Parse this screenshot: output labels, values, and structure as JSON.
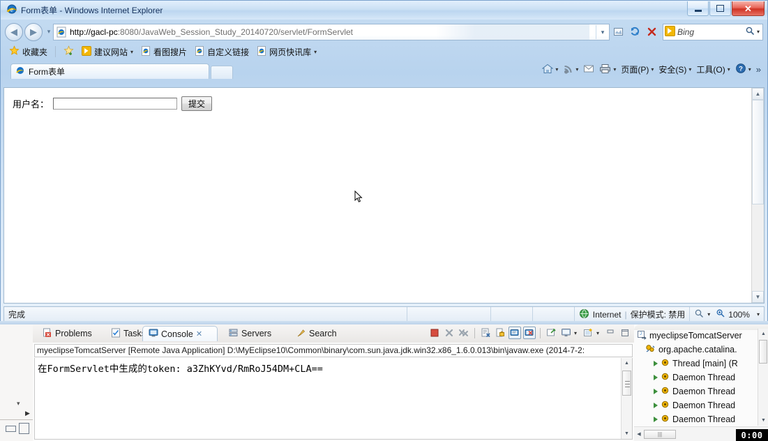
{
  "browser": {
    "title": "Form表单 - Windows Internet Explorer",
    "window_controls": {
      "minimize": "minimize-button",
      "maximize": "maximize-button",
      "close": "close-button"
    },
    "address": {
      "protocol_host": "http://gacl-pc",
      "rest": ":8080/JavaWeb_Session_Study_20140720/servlet/FormServlet",
      "full": "http://gacl-pc:8080/JavaWeb_Session_Study_20140720/servlet/FormServlet"
    },
    "search": {
      "engine": "Bing",
      "placeholder": "Bing"
    },
    "favorites": {
      "label": "收藏夹",
      "items": [
        {
          "label": "建议网站",
          "has_caret": true
        },
        {
          "label": "看图搜片",
          "has_caret": false
        },
        {
          "label": "自定义链接",
          "has_caret": false
        },
        {
          "label": "网页快讯库",
          "has_caret": true
        }
      ]
    },
    "tab": {
      "label": "Form表单"
    },
    "command_bar": [
      {
        "label": "",
        "icon": "home-icon",
        "caret": true
      },
      {
        "label": "",
        "icon": "rss-icon",
        "caret": true
      },
      {
        "label": "",
        "icon": "mail-icon",
        "caret": false
      },
      {
        "label": "",
        "icon": "print-icon",
        "caret": true
      },
      {
        "label": "页面(P)",
        "icon": "",
        "caret": true
      },
      {
        "label": "安全(S)",
        "icon": "",
        "caret": true
      },
      {
        "label": "工具(O)",
        "icon": "",
        "caret": true
      },
      {
        "label": "",
        "icon": "help-icon",
        "caret": true
      }
    ],
    "command_bar_overflow": "»",
    "status": {
      "text": "完成",
      "zone": "Internet",
      "protected_mode": "保护模式: 禁用",
      "zoom": "100%"
    }
  },
  "page": {
    "form": {
      "label": "用户名：",
      "input_value": "",
      "input_placeholder": "",
      "submit_label": "提交"
    }
  },
  "eclipse": {
    "tabs": [
      {
        "label": "Problems",
        "icon": "problems-icon",
        "active": false
      },
      {
        "label": "Tasks",
        "icon": "tasks-icon",
        "active": false
      },
      {
        "label": "Console",
        "icon": "console-icon",
        "active": true,
        "closable": true
      },
      {
        "label": "Servers",
        "icon": "servers-icon",
        "active": false
      },
      {
        "label": "Search",
        "icon": "search-icon",
        "active": false
      }
    ],
    "toolbar": [
      {
        "name": "terminate-button",
        "icon": "stop-square"
      },
      {
        "name": "remove-launch-button",
        "icon": "x-gray"
      },
      {
        "name": "remove-all-terminated-button",
        "icon": "xx-gray"
      },
      {
        "name": "clear-console-button",
        "icon": "clear-doc"
      },
      {
        "name": "scroll-lock-button",
        "icon": "lock"
      },
      {
        "name": "show-console-on-output-button",
        "icon": "console-out",
        "pressed": true
      },
      {
        "name": "show-console-on-error-button",
        "icon": "console-err",
        "pressed": true
      },
      {
        "name": "pin-console-button",
        "icon": "pin"
      },
      {
        "name": "display-selected-console-button",
        "icon": "monitor",
        "caret": true
      },
      {
        "name": "open-console-button",
        "icon": "new-console",
        "caret": true
      },
      {
        "name": "minimize-view-button",
        "icon": "minimize"
      },
      {
        "name": "maximize-view-button",
        "icon": "maximize"
      }
    ],
    "console": {
      "header": "myeclipseTomcatServer [Remote Java Application] D:\\MyEclipse10\\Common\\binary\\com.sun.java.jdk.win32.x86_1.6.0.013\\bin\\javaw.exe (2014-7-2:",
      "lines": [
        "在FormServlet中生成的token: a3ZhKYvd/RmRoJ54DM+CLA=="
      ]
    },
    "debug_tree": [
      {
        "level": 0,
        "label": "myeclipseTomcatServer",
        "icon": "launch-icon"
      },
      {
        "level": 1,
        "label": "org.apache.catalina.",
        "icon": "debug-target-icon"
      },
      {
        "level": 2,
        "label": "Thread [main] (R",
        "icon": "thread-icon"
      },
      {
        "level": 2,
        "label": "Daemon Thread",
        "icon": "thread-icon"
      },
      {
        "level": 2,
        "label": "Daemon Thread",
        "icon": "thread-icon"
      },
      {
        "level": 2,
        "label": "Daemon Thread",
        "icon": "thread-icon"
      },
      {
        "level": 2,
        "label": "Daemon Thread",
        "icon": "thread-icon"
      }
    ],
    "clock": "0:00"
  }
}
